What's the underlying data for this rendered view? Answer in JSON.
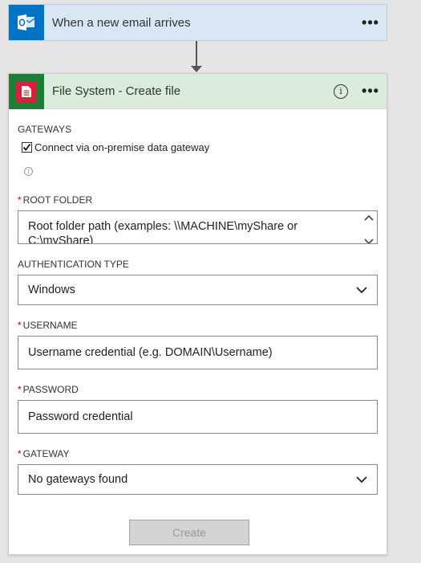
{
  "trigger": {
    "title": "When a new email arrives",
    "icon": "outlook-icon",
    "more": "•••"
  },
  "action": {
    "title": "File System - Create file",
    "icon": "file-system-icon",
    "info": "i",
    "more": "•••",
    "colors": {
      "header_bg": "#dcecdc",
      "icon_bg": "#1f7d36",
      "icon_accent": "#d8203f"
    }
  },
  "gateways": {
    "label": "GATEWAYS",
    "checkbox_label": "Connect via on-premise data gateway",
    "checked": true
  },
  "root_folder": {
    "required": "*",
    "label": "ROOT FOLDER",
    "placeholder": "Root folder path (examples: \\\\MACHINE\\myShare or C:\\myShare)"
  },
  "auth_type": {
    "label": "AUTHENTICATION TYPE",
    "value": "Windows"
  },
  "username": {
    "required": "*",
    "label": "USERNAME",
    "placeholder": "Username credential (e.g. DOMAIN\\Username)"
  },
  "password": {
    "required": "*",
    "label": "PASSWORD",
    "placeholder": "Password credential"
  },
  "gateway": {
    "required": "*",
    "label": "GATEWAY",
    "value": "No gateways found"
  },
  "create_label": "Create"
}
